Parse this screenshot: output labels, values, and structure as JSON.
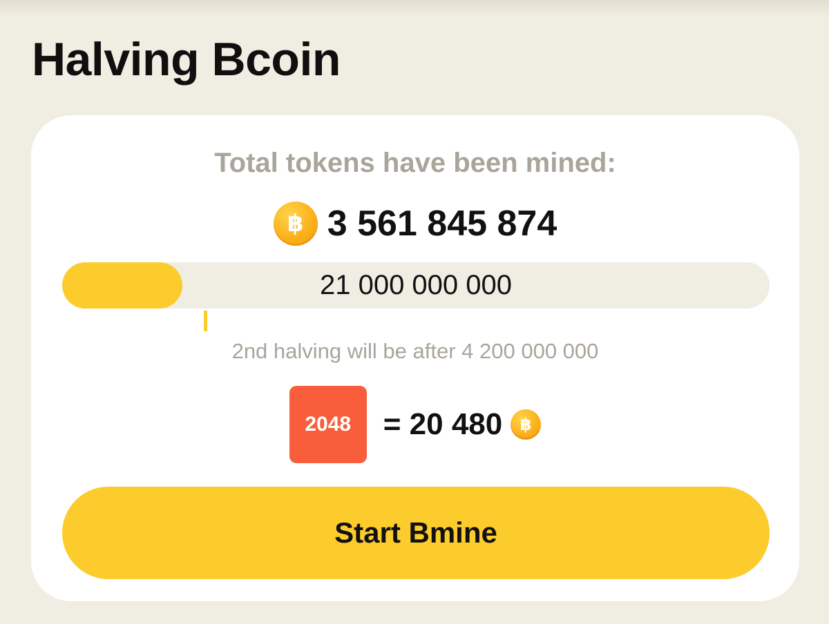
{
  "page": {
    "title": "Halving Bcoin"
  },
  "stats": {
    "mined_label": "Total tokens have been mined:",
    "mined_value": "3 561 845 874",
    "coin_symbol": "฿",
    "supply_label": "21 000 000 000",
    "mined_fraction": 0.17,
    "halving_marker_fraction": 0.2,
    "halving_note": "2nd halving will be after 4 200 000 000"
  },
  "reward": {
    "tile_label": "2048",
    "equals_value": "= 20 480",
    "coin_symbol": "฿"
  },
  "actions": {
    "start_label": "Start Bmine"
  },
  "colors": {
    "background": "#f0ede2",
    "card": "#ffffff",
    "accent_yellow": "#fccb2c",
    "tile_orange": "#f95e3c",
    "muted_text": "#aaa49b",
    "text": "#111111"
  },
  "icons": {
    "coin": "bitcoin-coin-icon"
  }
}
